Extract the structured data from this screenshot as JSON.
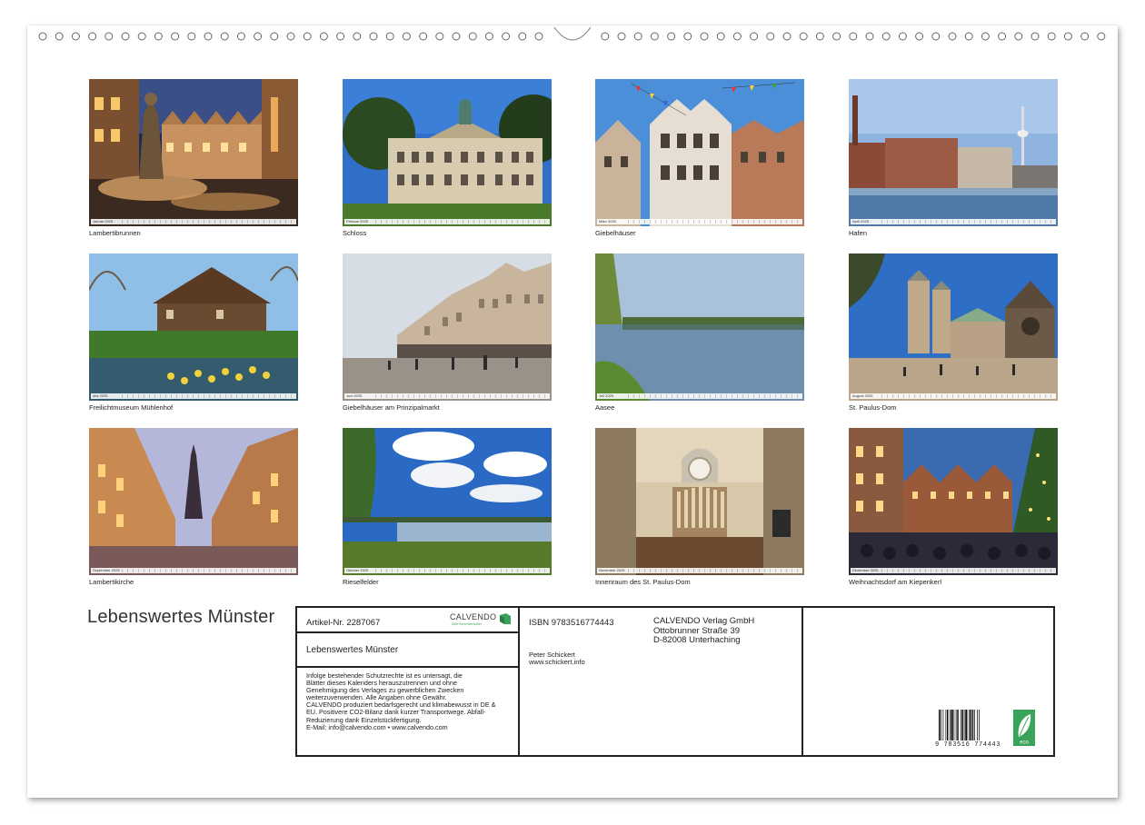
{
  "colors": {
    "paper": "#ffffff",
    "ink": "#222222",
    "brand_green": "#3aa35a"
  },
  "thumbnails": [
    {
      "month": "Januar 2025",
      "caption": "Lambertibrunnen",
      "scene": "night-fountain"
    },
    {
      "month": "Februar 2025",
      "caption": "Schloss",
      "scene": "palace"
    },
    {
      "month": "März 2025",
      "caption": "Giebelhäuser",
      "scene": "gables-flags"
    },
    {
      "month": "April 2025",
      "caption": "Hafen",
      "scene": "harbor"
    },
    {
      "month": "Mai 2025",
      "caption": "Freilichtmuseum Mühlenhof",
      "scene": "farmhouse"
    },
    {
      "month": "Juni 2025",
      "caption": "Giebelhäuser am Prinzipalmarkt",
      "scene": "square-day"
    },
    {
      "month": "Juli 2025",
      "caption": "Aasee",
      "scene": "lake"
    },
    {
      "month": "August 2025",
      "caption": "St. Paulus-Dom",
      "scene": "cathedral"
    },
    {
      "month": "September 2025",
      "caption": "Lambertikirche",
      "scene": "night-street"
    },
    {
      "month": "Oktober 2025",
      "caption": "Rieselfelder",
      "scene": "wetland"
    },
    {
      "month": "November 2025",
      "caption": "Innenraum des St. Paulus-Dom",
      "scene": "interior"
    },
    {
      "month": "Dezember 2025",
      "caption": "Weihnachtsdorf am Kiepenkerl",
      "scene": "xmas"
    }
  ],
  "title": "Lebenswertes Münster",
  "info": {
    "article": "Artikel-Nr. 2287067",
    "logo_text": "CALVENDO",
    "logo_sub": "Sehr mehr/Wertvoller",
    "calendar_name": "Lebenswertes Münster",
    "legal_lines": [
      "Infolge bestehender Schutzrechte ist es untersagt, die",
      "Blätter dieses Kalenders herauszutrennen und ohne",
      "Genehmigung des Verlages zu gewerblichen Zwecken",
      "weiterzuverwenden. Alle Angaben ohne Gewähr.",
      "CALVENDO produziert bedarfsgerecht und klimabewusst in DE &",
      "EU. Positivere CO2-Bilanz dank kurzer Transportwege. Abfall-",
      "Reduzierung dank Einzelstückfertigung.",
      "E-Mail: info@calvendo.com • www.calvendo.com"
    ],
    "isbn": "ISBN 9783516774443",
    "publisher_lines": [
      "CALVENDO Verlag GmbH",
      "Ottobrunner Straße 39",
      "D-82008 Unterhaching"
    ],
    "author_lines": [
      "Peter Schickert",
      "www.schickert.info"
    ],
    "barcode_digits": "9 783516 774443",
    "eco_label": "eco"
  }
}
